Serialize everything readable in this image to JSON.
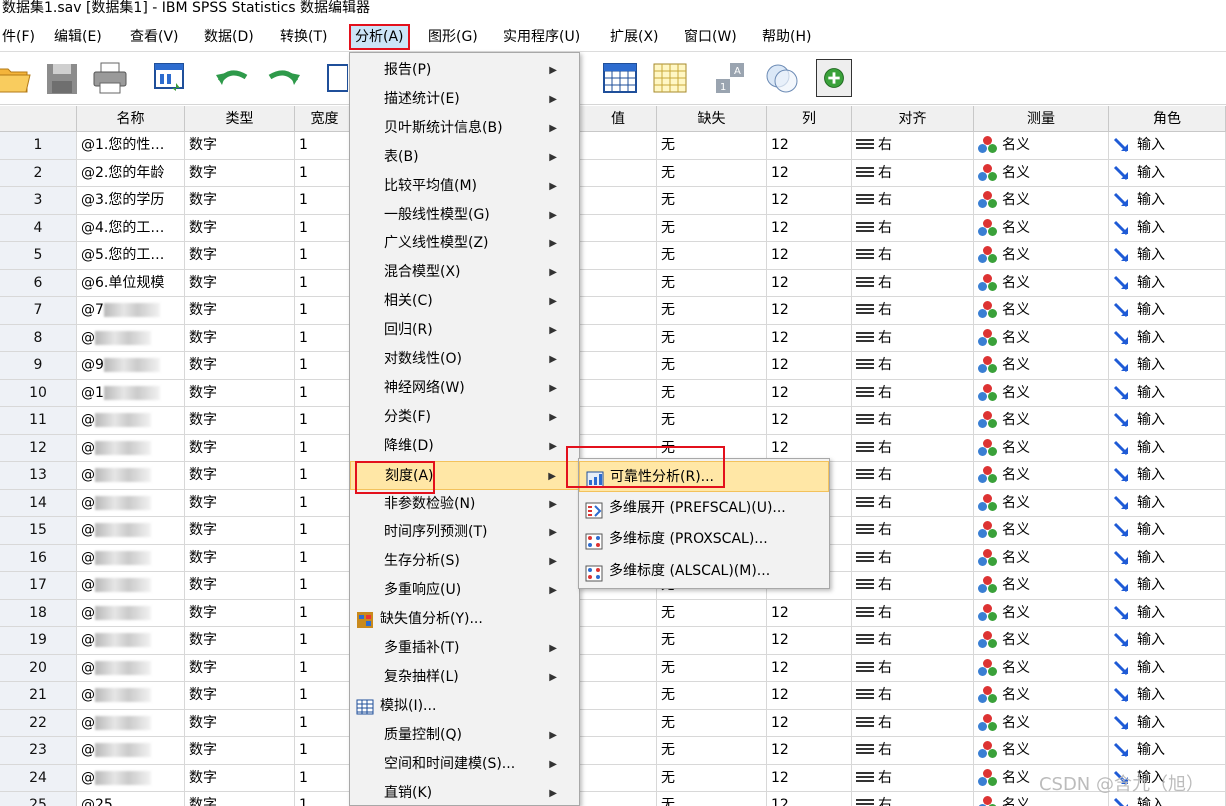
{
  "window": {
    "title": "数据集1.sav [数据集1] - IBM SPSS Statistics 数据编辑器"
  },
  "menubar": [
    {
      "label": "件(F)"
    },
    {
      "label": "编辑(E)"
    },
    {
      "label": "查看(V)"
    },
    {
      "label": "数据(D)"
    },
    {
      "label": "转换(T)"
    },
    {
      "label": "分析(A)"
    },
    {
      "label": "图形(G)"
    },
    {
      "label": "实用程序(U)"
    },
    {
      "label": "扩展(X)"
    },
    {
      "label": "窗口(W)"
    },
    {
      "label": "帮助(H)"
    }
  ],
  "toolbar": {
    "icons": [
      "open-folder-icon",
      "save-icon",
      "print-icon",
      "dialog-recall-icon",
      "undo-icon",
      "redo-icon",
      "goto-case-icon",
      "split-file-icon",
      "weight-cases-icon",
      "select-cases-icon",
      "value-labels-icon",
      "use-sets-icon",
      "add-icon"
    ]
  },
  "grid": {
    "columns": [
      "名称",
      "类型",
      "宽度",
      "值",
      "缺失",
      "列",
      "对齐",
      "测量",
      "角色"
    ],
    "rows": [
      {
        "num": "1",
        "name": "@1.您的性…",
        "type": "数字",
        "width": "1"
      },
      {
        "num": "2",
        "name": "@2.您的年龄",
        "type": "数字",
        "width": "1"
      },
      {
        "num": "3",
        "name": "@3.您的学历",
        "type": "数字",
        "width": "1"
      },
      {
        "num": "4",
        "name": "@4.您的工…",
        "type": "数字",
        "width": "1"
      },
      {
        "num": "5",
        "name": "@5.您的工…",
        "type": "数字",
        "width": "1"
      },
      {
        "num": "6",
        "name": "@6.单位规模",
        "type": "数字",
        "width": "1"
      },
      {
        "num": "7",
        "name": "@7",
        "type": "数字",
        "width": "1"
      },
      {
        "num": "8",
        "name": "@",
        "type": "数字",
        "width": "1"
      },
      {
        "num": "9",
        "name": "@9",
        "type": "数字",
        "width": "1"
      },
      {
        "num": "10",
        "name": "@1",
        "type": "数字",
        "width": "1"
      },
      {
        "num": "11",
        "name": "@",
        "type": "数字",
        "width": "1"
      },
      {
        "num": "12",
        "name": "@",
        "type": "数字",
        "width": "1"
      },
      {
        "num": "13",
        "name": "@",
        "type": "数字",
        "width": "1"
      },
      {
        "num": "14",
        "name": "@",
        "type": "数字",
        "width": "1"
      },
      {
        "num": "15",
        "name": "@",
        "type": "数字",
        "width": "1"
      },
      {
        "num": "16",
        "name": "@",
        "type": "数字",
        "width": "1"
      },
      {
        "num": "17",
        "name": "@",
        "type": "数字",
        "width": "1"
      },
      {
        "num": "18",
        "name": "@",
        "type": "数字",
        "width": "1"
      },
      {
        "num": "19",
        "name": "@",
        "type": "数字",
        "width": "1"
      },
      {
        "num": "20",
        "name": "@",
        "type": "数字",
        "width": "1"
      },
      {
        "num": "21",
        "name": "@",
        "type": "数字",
        "width": "1"
      },
      {
        "num": "22",
        "name": "@",
        "type": "数字",
        "width": "1"
      },
      {
        "num": "23",
        "name": "@",
        "type": "数字",
        "width": "1"
      },
      {
        "num": "24",
        "name": "@",
        "type": "数字",
        "width": "1"
      },
      {
        "num": "25",
        "name": "@25",
        "type": "数字",
        "width": "1"
      }
    ],
    "cell_values": {
      "missing": "无",
      "columns": "12",
      "align": "右",
      "measure": "名义",
      "role": "输入"
    }
  },
  "analyze_menu": [
    {
      "label": "报告(P)",
      "submenu": true
    },
    {
      "label": "描述统计(E)",
      "submenu": true
    },
    {
      "label": "贝叶斯统计信息(B)",
      "submenu": true
    },
    {
      "label": "表(B)",
      "submenu": true
    },
    {
      "label": "比较平均值(M)",
      "submenu": true
    },
    {
      "label": "一般线性模型(G)",
      "submenu": true
    },
    {
      "label": "广义线性模型(Z)",
      "submenu": true
    },
    {
      "label": "混合模型(X)",
      "submenu": true
    },
    {
      "label": "相关(C)",
      "submenu": true
    },
    {
      "label": "回归(R)",
      "submenu": true
    },
    {
      "label": "对数线性(O)",
      "submenu": true
    },
    {
      "label": "神经网络(W)",
      "submenu": true
    },
    {
      "label": "分类(F)",
      "submenu": true
    },
    {
      "label": "降维(D)",
      "submenu": true
    },
    {
      "label": "刻度(A)",
      "submenu": true
    },
    {
      "label": "非参数检验(N)",
      "submenu": true
    },
    {
      "label": "时间序列预测(T)",
      "submenu": true
    },
    {
      "label": "生存分析(S)",
      "submenu": true
    },
    {
      "label": "多重响应(U)",
      "submenu": true
    },
    {
      "label": "缺失值分析(Y)...",
      "submenu": false,
      "icon": "missing-value-icon"
    },
    {
      "label": "多重插补(T)",
      "submenu": true
    },
    {
      "label": "复杂抽样(L)",
      "submenu": true
    },
    {
      "label": "模拟(I)...",
      "submenu": false,
      "icon": "simulation-icon"
    },
    {
      "label": "质量控制(Q)",
      "submenu": true
    },
    {
      "label": "空间和时间建模(S)...",
      "submenu": true
    },
    {
      "label": "直销(K)",
      "submenu": true
    }
  ],
  "scale_submenu": [
    {
      "label": "可靠性分析(R)...",
      "icon": "reliability-analysis-icon"
    },
    {
      "label": "多维展开 (PREFSCAL)(U)...",
      "icon": "prefscal-icon"
    },
    {
      "label": "多维标度 (PROXSCAL)...",
      "icon": "proxscal-icon"
    },
    {
      "label": "多维标度 (ALSCAL)(M)...",
      "icon": "alscal-icon"
    }
  ],
  "watermark": "CSDN @含九（旭）",
  "colors": {
    "highlight": "#ffe7a6",
    "annotation_red": "#e3101c",
    "menu_bg": "#f2f2f2"
  }
}
